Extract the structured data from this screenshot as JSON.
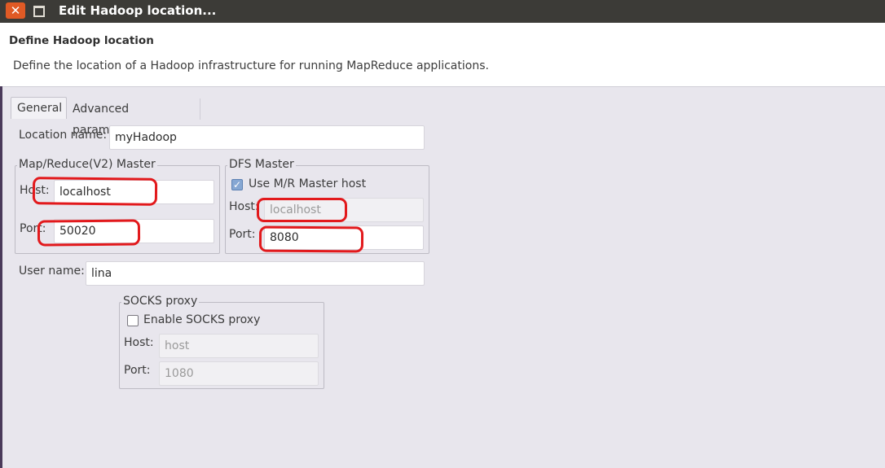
{
  "window": {
    "title": "Edit Hadoop location...",
    "close_glyph": "✕"
  },
  "header": {
    "title": "Define Hadoop location",
    "description": "Define the location of a Hadoop infrastructure for running MapReduce applications."
  },
  "tabs": [
    {
      "label": "General",
      "active": true
    },
    {
      "label": "Advanced parameters",
      "active": false
    }
  ],
  "general": {
    "location_name": {
      "label": "Location name:",
      "value": "myHadoop"
    },
    "mr_master": {
      "title": "Map/Reduce(V2) Master",
      "host": {
        "label": "Host:",
        "value": "localhost"
      },
      "port": {
        "label": "Port:",
        "value": "50020"
      }
    },
    "dfs_master": {
      "title": "DFS Master",
      "use_mr_host": {
        "label": "Use M/R Master host",
        "checked": true,
        "glyph": "✓"
      },
      "host": {
        "label": "Host:",
        "value": "localhost"
      },
      "port": {
        "label": "Port:",
        "value": "8080"
      }
    },
    "user_name": {
      "label": "User name:",
      "value": "lina"
    },
    "socks_proxy": {
      "title": "SOCKS proxy",
      "enable": {
        "label": "Enable SOCKS proxy",
        "checked": false
      },
      "host": {
        "label": "Host:",
        "value": "host"
      },
      "port": {
        "label": "Port:",
        "value": "1080"
      }
    }
  },
  "colors": {
    "annotation": "#e2191c",
    "close_button": "#e05a25",
    "titlebar": "#3c3b37"
  }
}
